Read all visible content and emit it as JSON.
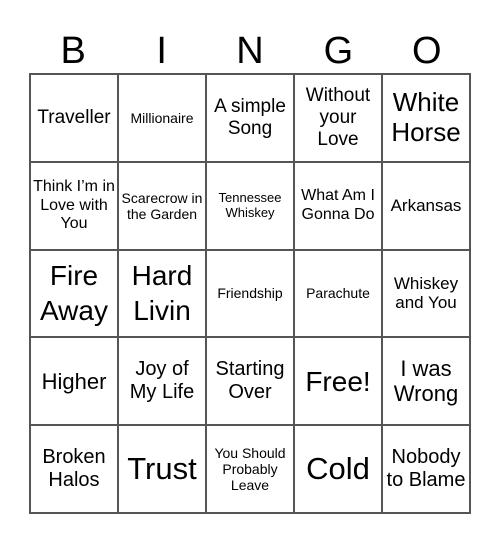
{
  "header": {
    "letters": [
      "B",
      "I",
      "N",
      "G",
      "O"
    ]
  },
  "cells": [
    "Traveller",
    "Millionaire",
    "A simple Song",
    "Without your Love",
    "White Horse",
    "Think I’m in Love with You",
    "Scarecrow in the Garden",
    "Tennessee Whiskey",
    "What Am I Gonna Do",
    "Arkansas",
    "Fire Away",
    "Hard Livin",
    "Friendship",
    "Parachute",
    "Whiskey and You",
    "Higher",
    "Joy of My Life",
    "Starting Over",
    "Free!",
    "I was Wrong",
    "Broken Halos",
    "Trust",
    "You Should Probably Leave",
    "Cold",
    "Nobody to Blame"
  ]
}
